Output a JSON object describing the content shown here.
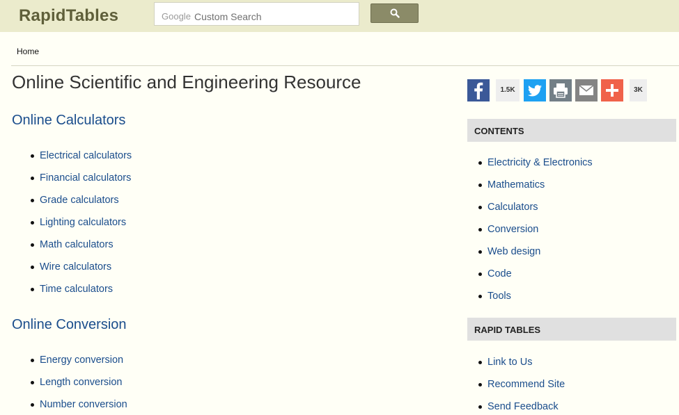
{
  "header": {
    "logo": "RapidTables",
    "search": {
      "brand": "Google",
      "placeholder": "Custom Search"
    },
    "search_icon": "magnifier-icon"
  },
  "breadcrumb": {
    "home": "Home"
  },
  "page_title": "Online Scientific and Engineering Resource",
  "sections": [
    {
      "title": "Online Calculators",
      "links": [
        "Electrical calculators",
        "Financial calculators",
        "Grade calculators",
        "Lighting calculators",
        "Math calculators",
        "Wire calculators",
        "Time calculators"
      ]
    },
    {
      "title": "Online Conversion",
      "links": [
        "Energy conversion",
        "Length conversion",
        "Number conversion"
      ]
    }
  ],
  "share": {
    "buttons": [
      {
        "icon": "facebook-icon",
        "color": "#3b5998"
      },
      {
        "icon": "twitter-icon",
        "color": "#1da1f2"
      },
      {
        "icon": "print-icon",
        "color": "#737f87"
      },
      {
        "icon": "email-icon",
        "color": "#848484"
      },
      {
        "icon": "plus-icon",
        "color": "#f0624a"
      }
    ],
    "facebook_count": "1.5K",
    "total_count": "3K"
  },
  "sidebar": {
    "contents_title": "CONTENTS",
    "contents": [
      "Electricity & Electronics",
      "Mathematics",
      "Calculators",
      "Conversion",
      "Web design",
      "Code",
      "Tools"
    ],
    "rapid_title": "RAPID TABLES",
    "rapid": [
      "Link to Us",
      "Recommend Site",
      "Send Feedback"
    ]
  }
}
